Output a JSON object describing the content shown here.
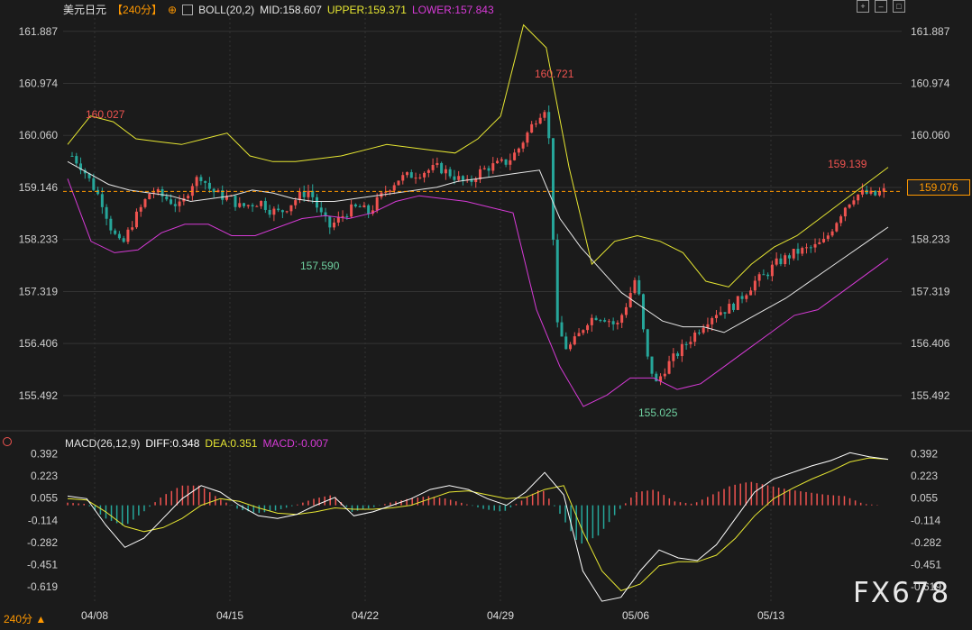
{
  "header": {
    "symbol": "美元日元",
    "period": "【240分】",
    "boll_title": "BOLL(20,2)",
    "mid": "MID:158.607",
    "upper": "UPPER:159.371",
    "lower": "LOWER:157.843"
  },
  "macd_header": {
    "title": "MACD(26,12,9)",
    "diff": "DIFF:0.348",
    "dea": "DEA:0.351",
    "macd": "MACD:-0.007"
  },
  "toolbar": {
    "icons": [
      "expand-icon",
      "minimize-icon",
      "maximize-icon"
    ]
  },
  "period_tag": "240分",
  "current_price": "159.076",
  "watermark": "FX678",
  "colors": {
    "up": "#ef5350",
    "down": "#26a69a",
    "mid": "#e6e6e6",
    "upper": "#e6e632",
    "lower": "#d63ad6",
    "diff": "#ffffff",
    "dea": "#e6e632",
    "grid": "#333333",
    "price_line": "#ff9800"
  },
  "chart_data": [
    {
      "type": "candlestick",
      "title": "美元日元 240分",
      "y_ticks": [
        "161.887",
        "160.974",
        "160.060",
        "159.146",
        "158.233",
        "157.319",
        "156.406",
        "155.492"
      ],
      "ylim": [
        155.0,
        162.2
      ],
      "x_ticks": [
        "04/08",
        "04/15",
        "04/22",
        "04/29",
        "05/06",
        "05/13"
      ],
      "annotations": [
        {
          "label": "160.027",
          "type": "high"
        },
        {
          "label": "157.590",
          "type": "low"
        },
        {
          "label": "160.721",
          "type": "high"
        },
        {
          "label": "155.025",
          "type": "low"
        },
        {
          "label": "159.139",
          "type": "high"
        }
      ],
      "close_path": [
        159.7,
        159.5,
        159.2,
        158.9,
        158.4,
        158.1,
        158.5,
        158.8,
        159.1,
        159.0,
        158.9,
        158.8,
        159.2,
        159.35,
        159.1,
        159.0,
        158.95,
        158.8,
        158.85,
        158.9,
        158.75,
        158.7,
        158.85,
        159.0,
        159.1,
        158.7,
        158.45,
        158.6,
        158.75,
        158.8,
        158.7,
        158.95,
        159.15,
        159.3,
        159.35,
        159.4,
        159.45,
        159.5,
        159.4,
        159.3,
        159.2,
        159.4,
        159.5,
        159.55,
        159.6,
        159.8,
        160.1,
        160.4,
        160.6,
        156.7,
        156.3,
        156.5,
        156.8,
        156.9,
        156.85,
        156.7,
        157.1,
        157.6,
        156.2,
        155.7,
        156.0,
        156.2,
        156.4,
        156.6,
        156.8,
        156.95,
        157.0,
        157.1,
        157.3,
        157.5,
        157.6,
        157.8,
        157.9,
        158.0,
        158.05,
        158.1,
        158.2,
        158.5,
        158.8,
        159.0,
        159.05,
        159.0,
        159.08
      ],
      "boll_mid_path": [
        159.6,
        159.4,
        159.2,
        159.1,
        159.05,
        159.0,
        158.9,
        158.95,
        159.0,
        159.1,
        159.05,
        158.95,
        158.9,
        158.9,
        158.95,
        159.0,
        159.05,
        159.1,
        159.15,
        159.25,
        159.3,
        159.35,
        159.4,
        159.45,
        158.6,
        158.1,
        157.7,
        157.3,
        157.05,
        156.8,
        156.7,
        156.7,
        156.6,
        156.8,
        157.0,
        157.2,
        157.45,
        157.7,
        157.95,
        158.2,
        158.45
      ],
      "boll_upper_path": [
        159.9,
        160.4,
        160.3,
        160.0,
        159.95,
        159.9,
        160.0,
        160.1,
        159.7,
        159.6,
        159.6,
        159.65,
        159.7,
        159.8,
        159.9,
        159.85,
        159.8,
        159.75,
        160.0,
        160.4,
        162.0,
        161.6,
        159.5,
        157.8,
        158.2,
        158.3,
        158.2,
        158.0,
        157.5,
        157.4,
        157.8,
        158.1,
        158.3,
        158.6,
        158.9,
        159.2,
        159.5
      ],
      "boll_lower_path": [
        159.3,
        158.2,
        158.0,
        158.05,
        158.35,
        158.5,
        158.5,
        158.3,
        158.3,
        158.45,
        158.6,
        158.65,
        158.6,
        158.7,
        158.9,
        159.0,
        158.95,
        158.9,
        158.8,
        158.7,
        157.0,
        156.0,
        155.3,
        155.5,
        155.8,
        155.8,
        155.6,
        155.7,
        156.0,
        156.3,
        156.6,
        156.9,
        157.0,
        157.3,
        157.6,
        157.9
      ]
    },
    {
      "type": "bar",
      "title": "MACD(26,12,9)",
      "y_ticks": [
        "0.392",
        "0.223",
        "0.055",
        "-0.114",
        "-0.282",
        "-0.451",
        "-0.619"
      ],
      "ylim": [
        -0.75,
        0.45
      ],
      "series": [
        {
          "name": "DIFF",
          "values": [
            0.07,
            0.05,
            -0.15,
            -0.32,
            -0.25,
            -0.1,
            0.05,
            0.15,
            0.1,
            0.0,
            -0.08,
            -0.1,
            -0.07,
            0.0,
            0.06,
            -0.08,
            -0.05,
            0.0,
            0.05,
            0.12,
            0.15,
            0.12,
            0.05,
            0.0,
            0.1,
            0.25,
            0.08,
            -0.5,
            -0.73,
            -0.7,
            -0.5,
            -0.34,
            -0.4,
            -0.42,
            -0.3,
            -0.1,
            0.1,
            0.2,
            0.25,
            0.3,
            0.34,
            0.4,
            0.37,
            0.35
          ]
        },
        {
          "name": "DEA",
          "values": [
            0.05,
            0.04,
            -0.05,
            -0.16,
            -0.2,
            -0.17,
            -0.1,
            0.0,
            0.05,
            0.03,
            -0.02,
            -0.06,
            -0.07,
            -0.05,
            -0.02,
            -0.03,
            -0.03,
            -0.02,
            0.0,
            0.05,
            0.1,
            0.11,
            0.08,
            0.05,
            0.06,
            0.12,
            0.15,
            -0.2,
            -0.5,
            -0.65,
            -0.6,
            -0.46,
            -0.43,
            -0.43,
            -0.38,
            -0.25,
            -0.08,
            0.05,
            0.13,
            0.2,
            0.26,
            0.33,
            0.36,
            0.35
          ]
        },
        {
          "name": "MACD",
          "values": [
            0.02,
            0.01,
            -0.1,
            -0.16,
            -0.05,
            0.07,
            0.15,
            0.15,
            0.05,
            -0.03,
            -0.06,
            -0.04,
            0.0,
            0.05,
            0.08,
            -0.05,
            -0.02,
            0.02,
            0.05,
            0.07,
            0.05,
            0.01,
            -0.03,
            -0.05,
            0.04,
            0.13,
            -0.07,
            -0.3,
            -0.23,
            -0.05,
            0.1,
            0.12,
            0.03,
            0.01,
            0.08,
            0.15,
            0.18,
            0.15,
            0.12,
            0.1,
            0.08,
            0.07,
            0.01,
            0.0
          ]
        }
      ]
    }
  ]
}
